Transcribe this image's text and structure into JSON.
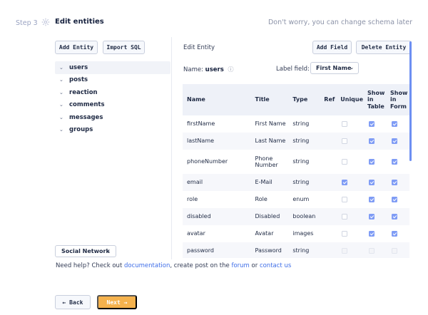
{
  "header": {
    "step": "Step 3",
    "gear_icon": "gear-icon",
    "title": "Edit entities",
    "hint": "Don't worry, you can change schema later"
  },
  "left_panel": {
    "add_entity_label": "Add Entity",
    "import_sql_label": "Import SQL",
    "entities": [
      {
        "label": "users",
        "active": true
      },
      {
        "label": "posts",
        "active": false
      },
      {
        "label": "reaction",
        "active": false
      },
      {
        "label": "comments",
        "active": false
      },
      {
        "label": "messages",
        "active": false
      },
      {
        "label": "groups",
        "active": false
      }
    ],
    "template_select": "Social Network"
  },
  "right_panel": {
    "title": "Edit Entity",
    "add_field_label": "Add Field",
    "delete_entity_label": "Delete Entity",
    "name_label": "Name:",
    "name_value": "users",
    "label_field_label": "Label field:",
    "label_field_value": "First Name",
    "columns": [
      "Name",
      "Title",
      "Type",
      "Ref",
      "Unique",
      "Show in Table",
      "Show in Form"
    ],
    "rows": [
      {
        "name": "firstName",
        "title": "First Name",
        "type": "string",
        "ref": "",
        "unique": false,
        "show_table": true,
        "show_form": true,
        "disabled": false
      },
      {
        "name": "lastName",
        "title": "Last Name",
        "type": "string",
        "ref": "",
        "unique": false,
        "show_table": true,
        "show_form": true,
        "disabled": false
      },
      {
        "name": "phoneNumber",
        "title": "Phone Number",
        "type": "string",
        "ref": "",
        "unique": false,
        "show_table": true,
        "show_form": true,
        "disabled": false
      },
      {
        "name": "email",
        "title": "E-Mail",
        "type": "string",
        "ref": "",
        "unique": true,
        "show_table": true,
        "show_form": true,
        "disabled": false
      },
      {
        "name": "role",
        "title": "Role",
        "type": "enum",
        "ref": "",
        "unique": false,
        "show_table": true,
        "show_form": true,
        "disabled": false
      },
      {
        "name": "disabled",
        "title": "Disabled",
        "type": "boolean",
        "ref": "",
        "unique": false,
        "show_table": true,
        "show_form": true,
        "disabled": false
      },
      {
        "name": "avatar",
        "title": "Avatar",
        "type": "images",
        "ref": "",
        "unique": false,
        "show_table": true,
        "show_form": true,
        "disabled": false
      },
      {
        "name": "password",
        "title": "Password",
        "type": "string",
        "ref": "",
        "unique": false,
        "show_table": false,
        "show_form": false,
        "disabled": true
      }
    ]
  },
  "help": {
    "prefix": "Need help? Check out ",
    "documentation": "documentation",
    "middle": ", create post on the ",
    "forum": "forum",
    "or": " or ",
    "contact": "contact us"
  },
  "footer": {
    "back_label": "← Back",
    "next_label": "Next  →"
  },
  "colors": {
    "accent": "#7f9cf5",
    "next_button": "#f5b24d",
    "link": "#3f6ee8"
  }
}
